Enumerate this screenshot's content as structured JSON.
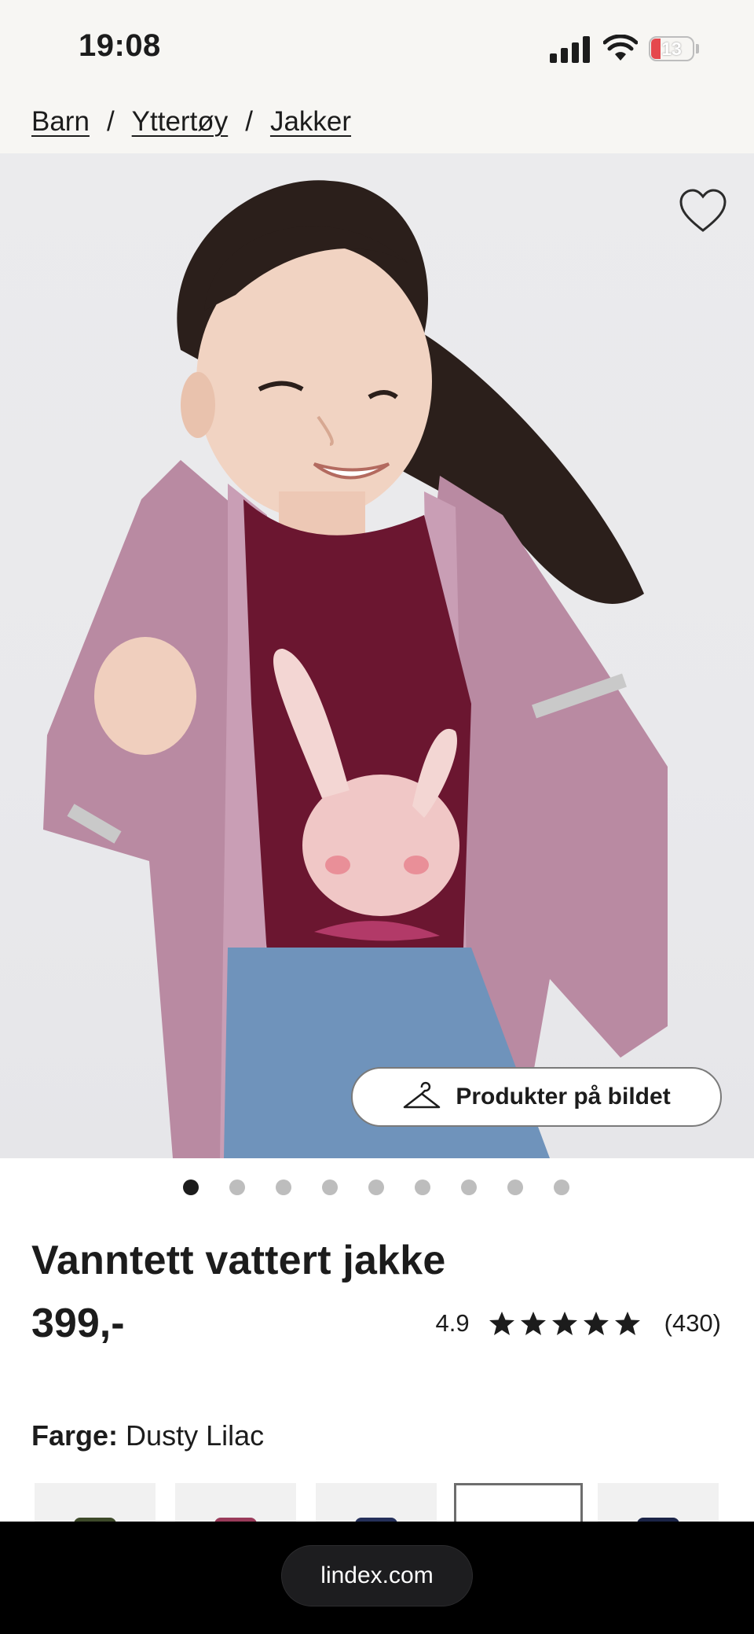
{
  "status_bar": {
    "time": "19:08",
    "battery": "13",
    "battery_color": "#e5484d"
  },
  "breadcrumb": [
    "Barn",
    "Yttertøy",
    "Jakker"
  ],
  "hero": {
    "favorite_icon": "heart-icon",
    "products_button_label": "Produkter på bildet",
    "products_button_icon": "hanger-icon"
  },
  "carousel": {
    "count": 9,
    "active_index": 0
  },
  "product": {
    "title": "Vanntett vattert jakke",
    "price": "399,-",
    "rating": {
      "score": "4.9",
      "stars": 5,
      "count": "(430)"
    },
    "color": {
      "label": "Farge:",
      "value": "Dusty Lilac"
    },
    "swatches": [
      {
        "color": "#3e4a2a",
        "selected": false
      },
      {
        "color": "#9a3b5a",
        "selected": false
      },
      {
        "color": "#25305a",
        "selected": false
      },
      {
        "color": "#ffffff",
        "selected": true
      },
      {
        "color": "#1b2447",
        "selected": false
      }
    ]
  },
  "browser": {
    "url": "lindex.com"
  }
}
